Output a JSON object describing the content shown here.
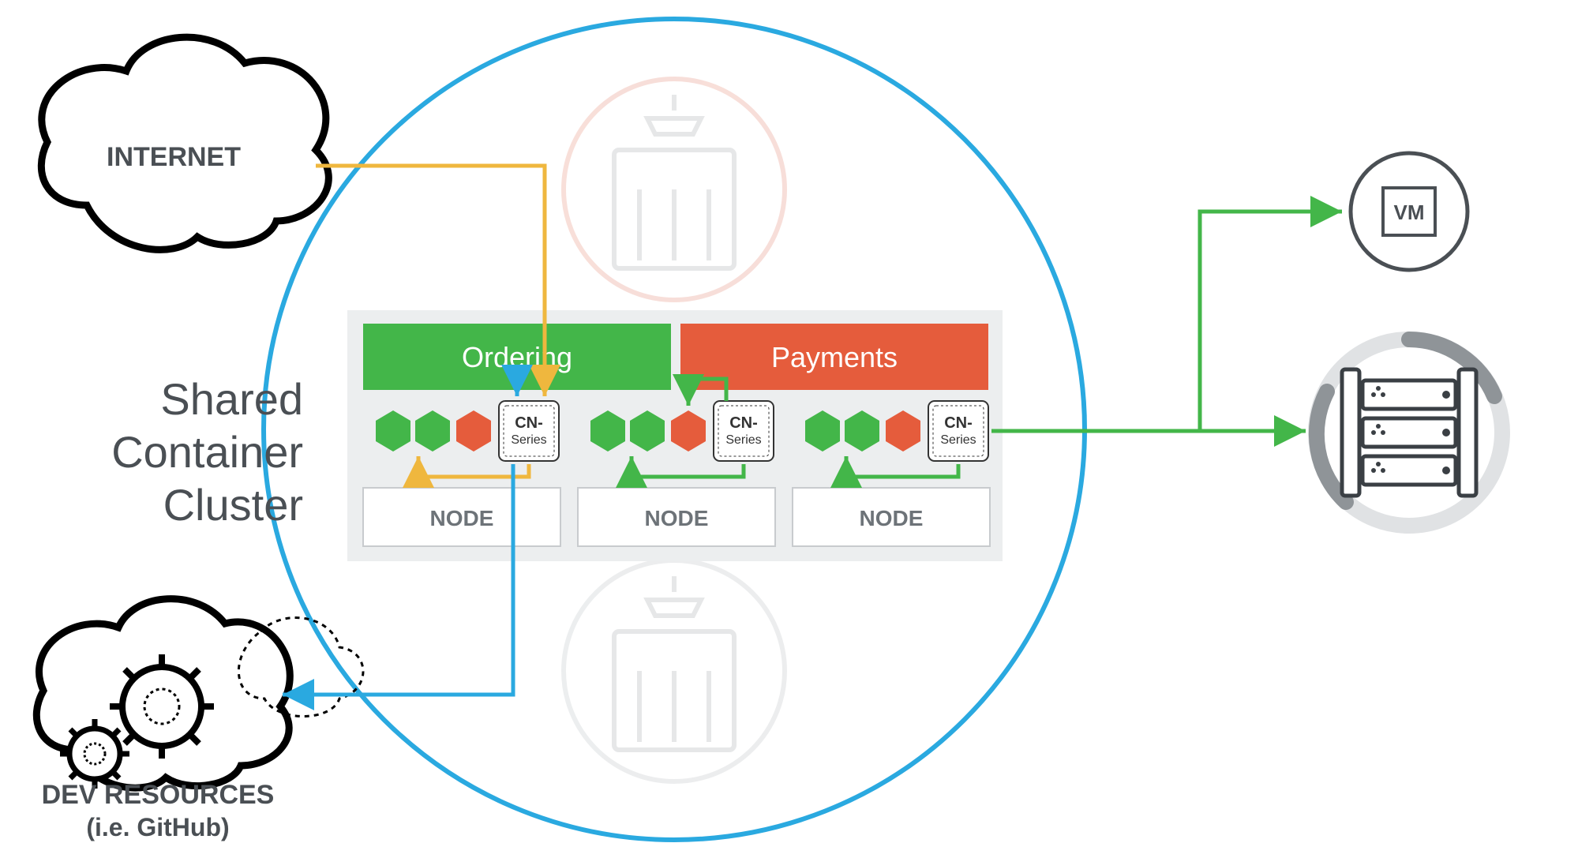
{
  "title_line1": "Shared",
  "title_line2": "Container",
  "title_line3": "Cluster",
  "internet": "INTERNET",
  "dev": "DEV RESOURCES",
  "dev_sub": "(i.e. GitHub)",
  "service1": "Ordering",
  "service2": "Payments",
  "node": "NODE",
  "cn": "CN-",
  "cn_sub": "Series",
  "vm": "VM",
  "colors": {
    "blue": "#2aa9e0",
    "green": "#43b649",
    "orange": "#e55c3c",
    "yellow": "#efb73e",
    "cyan": "#2aa9e0",
    "grey": "#e6e7e8",
    "greytext": "#4a4f54",
    "lightgrey": "#c8cbce"
  }
}
